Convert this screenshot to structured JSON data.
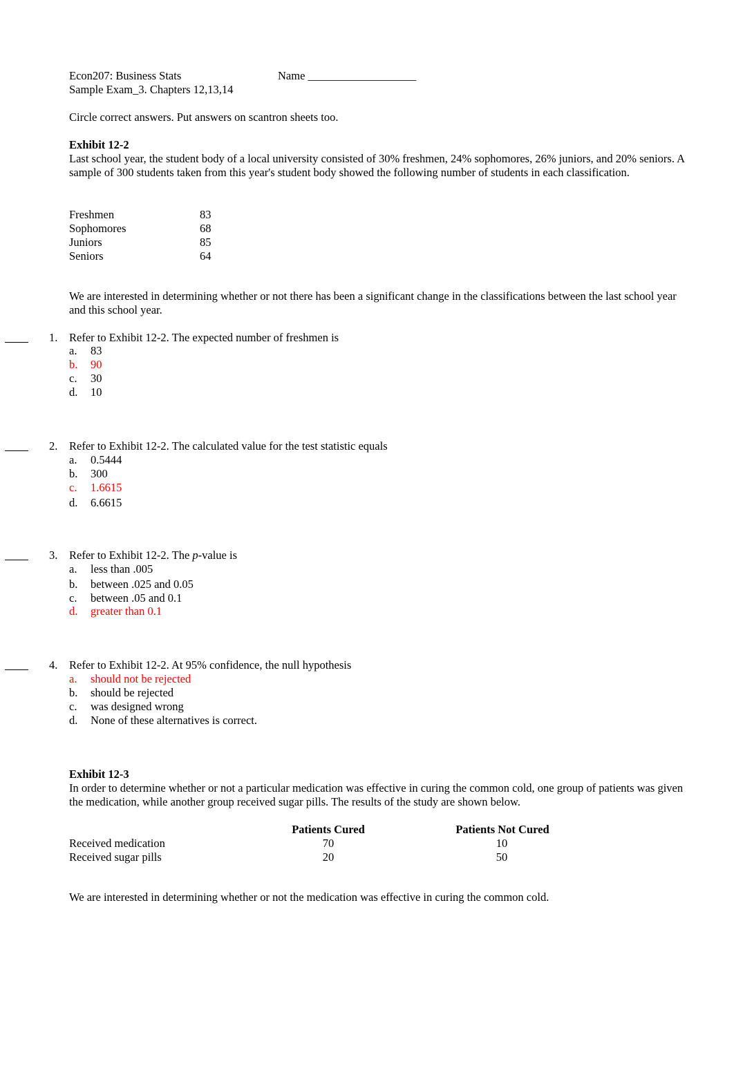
{
  "header": {
    "course": "Econ207: Business Stats",
    "name_label": "Name ___________________",
    "subtitle": "Sample Exam_3.  Chapters 12,13,14",
    "instructions": "Circle correct answers. Put answers on scantron sheets too."
  },
  "exhibit_12_2": {
    "title": "Exhibit 12-2",
    "description": "Last school year, the student body of a local university consisted of 30% freshmen, 24% sophomores, 26% juniors, and 20% seniors. A sample of 300 students taken from this year's student body showed the following number of students in each classification.",
    "table": [
      {
        "label": "Freshmen",
        "value": "83"
      },
      {
        "label": "Sophomores",
        "value": "68"
      },
      {
        "label": "Juniors",
        "value": "85"
      },
      {
        "label": "Seniors",
        "value": "64"
      }
    ],
    "note": "We are interested in determining whether or not there has been a significant change in the classifications between the last school year and this school year."
  },
  "questions": [
    {
      "number": "1.",
      "blank": "____",
      "text": "Refer to Exhibit 12-2. The expected number of freshmen is",
      "options": [
        {
          "letter": "a.",
          "text": "83",
          "correct": false
        },
        {
          "letter": "b.",
          "text": "90",
          "correct": true
        },
        {
          "letter": "c.",
          "text": "30",
          "correct": false
        },
        {
          "letter": "d.",
          "text": "10",
          "correct": false
        }
      ]
    },
    {
      "number": "2.",
      "blank": "____",
      "text": "Refer to Exhibit 12-2. The calculated value for the test statistic equals",
      "options": [
        {
          "letter": "a.",
          "text": "0.5444",
          "correct": false
        },
        {
          "letter": "b.",
          "text": "300",
          "correct": false
        },
        {
          "letter": "c.",
          "text": "1.6615",
          "correct": true
        },
        {
          "letter": "d.",
          "text": "6.6615",
          "correct": false
        }
      ]
    },
    {
      "number": "3.",
      "blank": "____",
      "text_before": "Refer to Exhibit 12-2. The ",
      "text_italic": "p",
      "text_after": "-value is",
      "options": [
        {
          "letter": "a.",
          "text": "less than .005",
          "correct": false
        },
        {
          "letter": "b.",
          "text": "between .025 and 0.05",
          "correct": false
        },
        {
          "letter": "c.",
          "text": "between .05 and 0.1",
          "correct": false
        },
        {
          "letter": "d.",
          "text": "greater than 0.1",
          "correct": true
        }
      ]
    },
    {
      "number": "4.",
      "blank": "____",
      "text": "Refer to Exhibit 12-2. At 95% confidence, the null hypothesis",
      "options": [
        {
          "letter": "a.",
          "text": "should not be rejected",
          "correct": true
        },
        {
          "letter": "b.",
          "text": "should be rejected",
          "correct": false
        },
        {
          "letter": "c.",
          "text": "was designed wrong",
          "correct": false
        },
        {
          "letter": "d.",
          "text": "None of these alternatives is correct.",
          "correct": false
        }
      ]
    }
  ],
  "exhibit_12_3": {
    "title": "Exhibit 12-3",
    "description": "In order to determine whether or not a particular medication was effective in curing the common cold, one group of patients was given the medication, while another group received sugar pills. The results of the study are shown below.",
    "columns": [
      "Patients Cured",
      "Patients Not Cured"
    ],
    "rows": [
      {
        "label": "Received medication",
        "values": [
          "70",
          "10"
        ]
      },
      {
        "label": "Received sugar pills",
        "values": [
          "20",
          "50"
        ]
      }
    ],
    "note": "We are interested in determining whether or not the medication was effective in curing the common cold."
  },
  "colors": {
    "correct_answer": "#ff0000",
    "text": "#000000"
  }
}
